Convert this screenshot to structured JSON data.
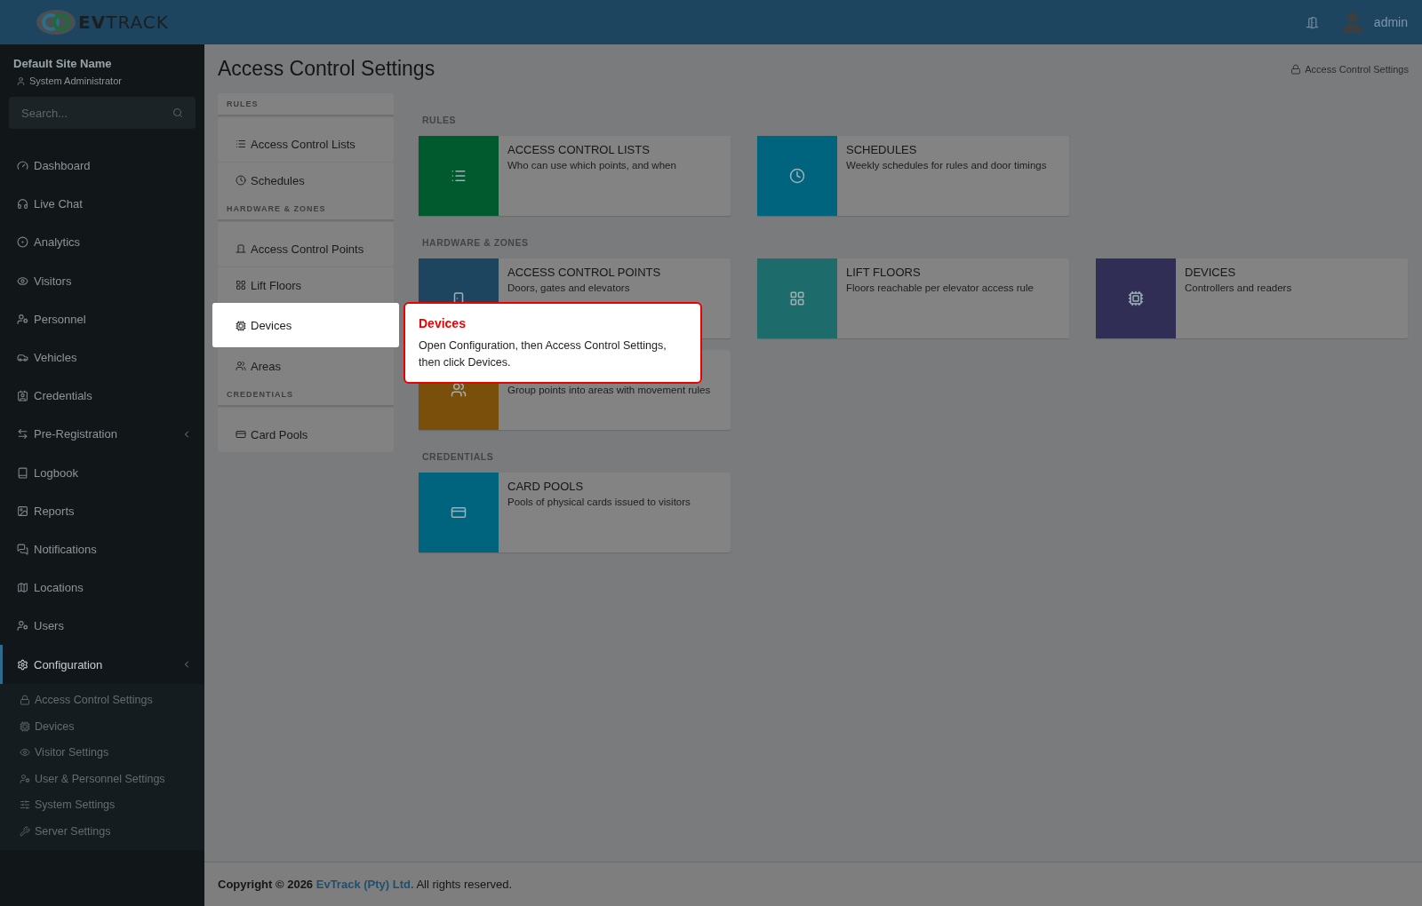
{
  "header": {
    "logo": "**EV**TRACK",
    "user": "admin"
  },
  "sidebar": {
    "site_name": "Default Site Name",
    "role": "System Administrator",
    "search": {
      "placeholder": "Search..."
    },
    "items": [
      {
        "label": "Dashboard",
        "kind": "link",
        "selected": false
      },
      {
        "label": "Live Chat",
        "kind": "link",
        "selected": false
      },
      {
        "label": "Analytics",
        "kind": "link",
        "selected": false
      },
      {
        "label": "Visitors",
        "kind": "link",
        "selected": false
      },
      {
        "label": "Personnel",
        "kind": "link",
        "selected": false
      },
      {
        "label": "Vehicles",
        "kind": "link",
        "selected": false
      },
      {
        "label": "Credentials",
        "kind": "link",
        "selected": false
      },
      {
        "label": "Pre-Registration",
        "kind": "group",
        "selected": false
      },
      {
        "label": "Logbook",
        "kind": "link",
        "selected": false
      },
      {
        "label": "Reports",
        "kind": "link",
        "selected": false
      },
      {
        "label": "Notifications",
        "kind": "link",
        "selected": false
      },
      {
        "label": "Locations",
        "kind": "link",
        "selected": false
      },
      {
        "label": "Users",
        "kind": "link",
        "selected": false
      },
      {
        "label": "Configuration",
        "kind": "group",
        "selected": true,
        "children": [
          {
            "label": "Access Control Settings",
            "selected": false
          },
          {
            "label": "Devices",
            "selected": false
          },
          {
            "label": "Visitor Settings",
            "selected": false
          },
          {
            "label": "User & Personnel Settings",
            "selected": false
          },
          {
            "label": "System Settings",
            "selected": false
          },
          {
            "label": "Server Settings",
            "selected": false
          }
        ]
      }
    ]
  },
  "page": {
    "title": "Access Control Settings",
    "breadcrumb": "Access Control Settings"
  },
  "settings_nav": [
    {
      "heading": "RULES",
      "items": [
        {
          "label": "Access Control Lists",
          "highlighted": false
        },
        {
          "label": "Schedules",
          "highlighted": false
        }
      ]
    },
    {
      "heading": "HARDWARE & ZONES",
      "items": [
        {
          "label": "Access Control Points",
          "highlighted": false
        },
        {
          "label": "Lift Floors",
          "highlighted": false
        },
        {
          "label": "Devices",
          "highlighted": true
        },
        {
          "label": "Areas",
          "highlighted": false
        }
      ]
    },
    {
      "heading": "CREDENTIALS",
      "items": [
        {
          "label": "Card Pools",
          "highlighted": false
        }
      ]
    }
  ],
  "tooltip": {
    "title": "Devices",
    "body": "Open Configuration, then Access Control Settings, then click Devices."
  },
  "tile_sections": [
    {
      "heading": "RULES",
      "tiles": [
        {
          "title": "ACCESS CONTROL LISTS",
          "description": "Who can use which points, and when",
          "color": "#005a2e"
        },
        {
          "title": "SCHEDULES",
          "description": "Weekly schedules for rules and door timings",
          "color": "#00647f"
        }
      ]
    },
    {
      "heading": "HARDWARE & ZONES",
      "tiles": [
        {
          "title": "ACCESS CONTROL POINTS",
          "description": "Doors, gates and elevators",
          "color": "#1e4560"
        },
        {
          "title": "LIFT FLOORS",
          "description": "Floors reachable per elevator access rule",
          "color": "#1e6b6b"
        },
        {
          "title": "DEVICES",
          "description": "Controllers and readers",
          "color": "#302e55"
        },
        {
          "description": "Group points into areas with movement rules",
          "color": "#7a4f0b"
        }
      ]
    },
    {
      "heading": "CREDENTIALS",
      "tiles": [
        {
          "title": "CARD POOLS",
          "description": "Pools of physical cards issued to visitors",
          "color": "#00647f"
        }
      ]
    }
  ],
  "footer": {
    "prefix": "Copyright © 2026",
    "link": "EvTrack (Pty) Ltd.",
    "suffix": "All rights reserved."
  }
}
